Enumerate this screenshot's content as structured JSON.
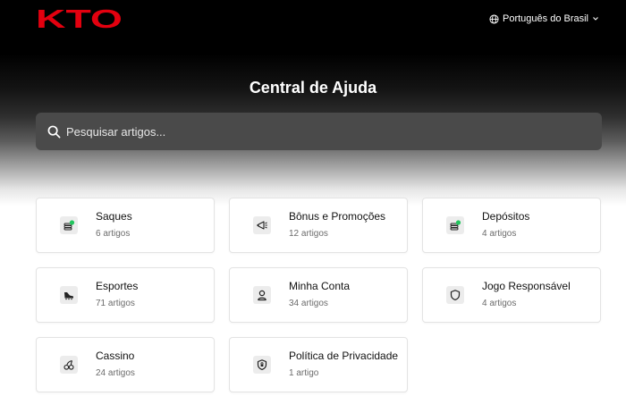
{
  "brand": {
    "logo_text": "KTO",
    "color": "#e3000f"
  },
  "language": {
    "label": "Português do Brasil",
    "icon": "globe-icon",
    "chevron": "chevron-down-icon"
  },
  "title": "Central de Ajuda",
  "search": {
    "placeholder": "Pesquisar artigos...",
    "value": "",
    "icon": "search-icon"
  },
  "categories": [
    {
      "title": "Saques",
      "count": "6 artigos",
      "icon": "coins-icon"
    },
    {
      "title": "Bônus e Promoções",
      "count": "12 artigos",
      "icon": "megaphone-icon"
    },
    {
      "title": "Depósitos",
      "count": "4 artigos",
      "icon": "coins-icon"
    },
    {
      "title": "Esportes",
      "count": "71 artigos",
      "icon": "soccer-shoe-icon"
    },
    {
      "title": "Minha Conta",
      "count": "34 artigos",
      "icon": "user-icon"
    },
    {
      "title": "Jogo Responsável",
      "count": "4 artigos",
      "icon": "shield-icon"
    },
    {
      "title": "Cassino",
      "count": "24 artigos",
      "icon": "cherries-icon"
    },
    {
      "title": "Política de Privacidade",
      "count": "1 artigo",
      "icon": "shield-lock-icon"
    }
  ],
  "colors": {
    "accent_green": "#22c55e",
    "card_border": "#e3e3e3"
  }
}
